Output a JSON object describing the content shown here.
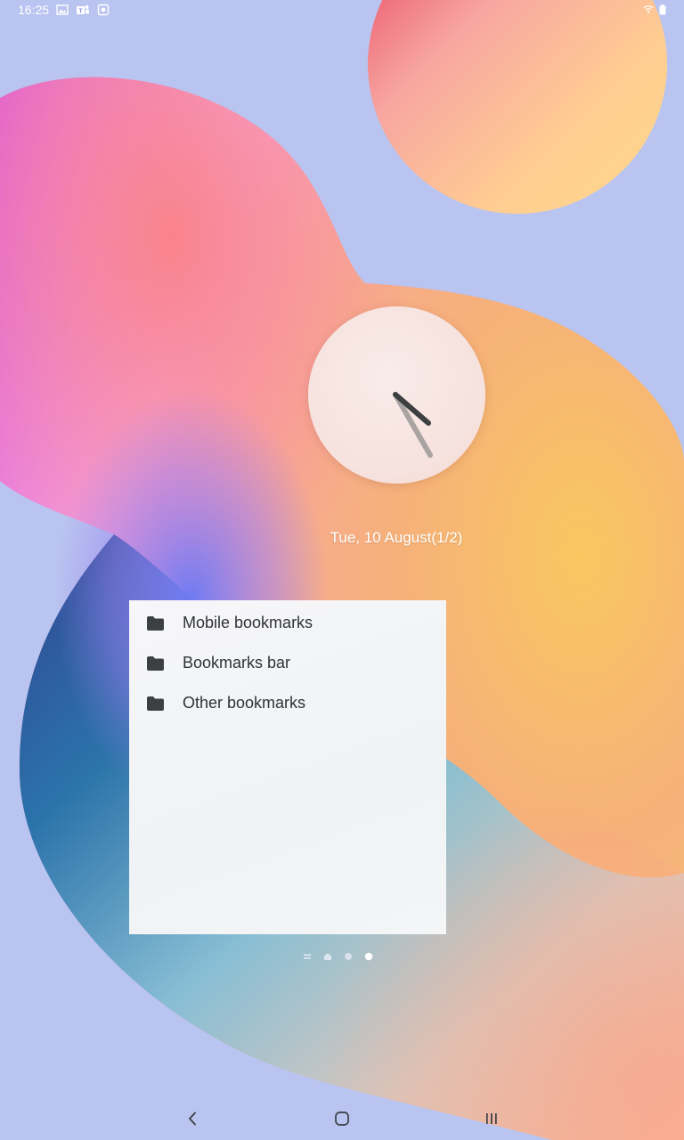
{
  "status_bar": {
    "time": "16:25",
    "left_icons": [
      "image-notification-icon",
      "teams-icon",
      "settings-notification-icon"
    ],
    "right_icons": [
      "wifi-icon",
      "battery-icon"
    ]
  },
  "clock": {
    "date_text": "Tue, 10 August(1/2)"
  },
  "bookmarks": {
    "items": [
      {
        "label": "Mobile bookmarks",
        "icon": "folder-icon"
      },
      {
        "label": "Bookmarks bar",
        "icon": "folder-icon"
      },
      {
        "label": "Other bookmarks",
        "icon": "folder-icon"
      }
    ]
  },
  "page_indicator": {
    "pages": 4,
    "current": 4
  },
  "nav_bar": {
    "buttons": [
      "back-icon",
      "home-icon",
      "recent-apps-icon"
    ]
  },
  "colors": {
    "background": "#b9c4f0",
    "widget_text": "#2f3335",
    "status_text": "#ffffff"
  }
}
